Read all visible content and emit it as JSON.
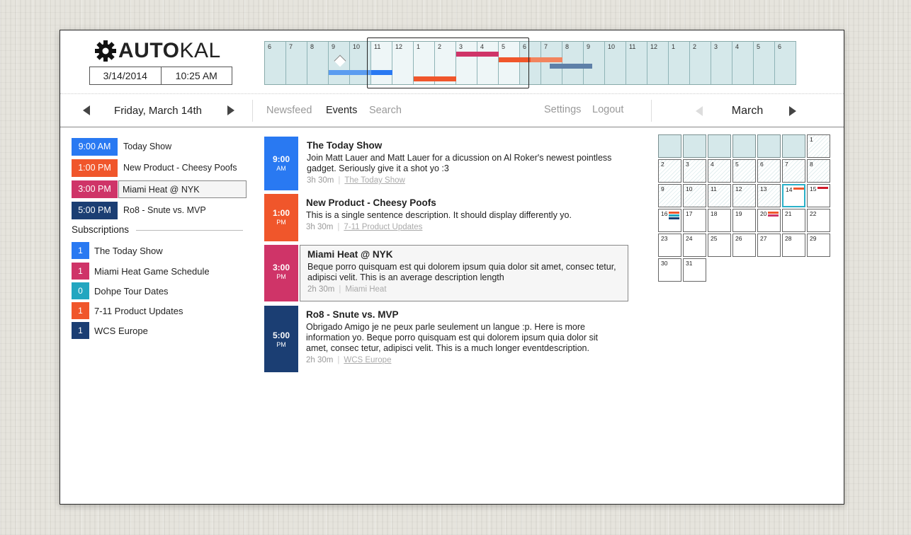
{
  "app": {
    "logo_bold": "AUTO",
    "logo_light": "KAL"
  },
  "clock": {
    "date": "3/14/2014",
    "time": "10:25 AM"
  },
  "timeline": {
    "hours": [
      "6",
      "7",
      "8",
      "9",
      "10",
      "11",
      "12",
      "1",
      "2",
      "3",
      "4",
      "5",
      "6",
      "7",
      "8",
      "9",
      "10",
      "11",
      "12",
      "1",
      "2",
      "3",
      "4",
      "5",
      "6"
    ]
  },
  "nav": {
    "day": "Friday, March 14th",
    "tabs": [
      "Newsfeed",
      "Events",
      "Search"
    ],
    "active_tab": "Events",
    "settings": "Settings",
    "logout": "Logout",
    "month": "March"
  },
  "colors": {
    "blue": "#2979f2",
    "orange": "#f0562b",
    "magenta": "#cf3468",
    "teal": "#22a6c0",
    "navy": "#1b3e73"
  },
  "agenda": [
    {
      "time": "9:00 AM",
      "title": "Today Show",
      "color": "#2979f2"
    },
    {
      "time": "1:00 PM",
      "title": "New Product - Cheesy Poofs",
      "color": "#f0562b"
    },
    {
      "time": "3:00 PM",
      "title": "Miami Heat @ NYK",
      "color": "#cf3468"
    },
    {
      "time": "5:00 PM",
      "title": "Ro8 - Snute vs. MVP",
      "color": "#1b3e73"
    }
  ],
  "subscriptions_header": "Subscriptions",
  "subscriptions": [
    {
      "count": "1",
      "name": "The Today Show",
      "color": "#2979f2"
    },
    {
      "count": "1",
      "name": "Miami Heat Game Schedule",
      "color": "#cf3468"
    },
    {
      "count": "0",
      "name": "Dohpe Tour Dates",
      "color": "#22a6c0"
    },
    {
      "count": "1",
      "name": "7-11 Product Updates",
      "color": "#f0562b"
    },
    {
      "count": "1",
      "name": "WCS Europe",
      "color": "#1b3e73"
    }
  ],
  "events": [
    {
      "hour": "9:00",
      "meridiem": "AM",
      "title": "The Today Show",
      "desc": "Join Matt Lauer and Matt Lauer for a dicussion on Al Roker's newest pointless gadget. Seriously give it a shot yo :3",
      "duration": "3h 30m",
      "source": "The Today Show",
      "color": "#2979f2"
    },
    {
      "hour": "1:00",
      "meridiem": "PM",
      "title": "New Product - Cheesy Poofs",
      "desc": "This is a single sentence description. It should display differently yo.",
      "duration": "3h 30m",
      "source": "7-11 Product Updates",
      "color": "#f0562b"
    },
    {
      "hour": "3:00",
      "meridiem": "PM",
      "title": "Miami Heat @ NYK",
      "desc": "Beque porro quisquam est qui dolorem ipsum quia dolor sit amet, consec tetur, adipisci velit. This is an average description length",
      "duration": "2h 30m",
      "source": "Miami Heat",
      "color": "#cf3468"
    },
    {
      "hour": "5:00",
      "meridiem": "PM",
      "title": "Ro8 - Snute vs. MVP",
      "desc": "Obrigado Amigo je ne peux parle seulement un langue :p. Here is more information yo. Beque porro quisquam est qui dolorem ipsum quia dolor sit amet, consec tetur, adipisci velit. This is a much longer eventdescription.",
      "duration": "2h 30m",
      "source": "WCS Europe",
      "color": "#1b3e73"
    }
  ],
  "calendar": {
    "leading_blanks": 6,
    "days": 31,
    "today": 14,
    "marks": {
      "14": [
        "#f0562b"
      ],
      "15": [
        "#d11a2a"
      ],
      "16": [
        "#f0562b",
        "#22a6c0",
        "#1b3e73"
      ],
      "20": [
        "#f0562b",
        "#cf3468"
      ]
    }
  }
}
